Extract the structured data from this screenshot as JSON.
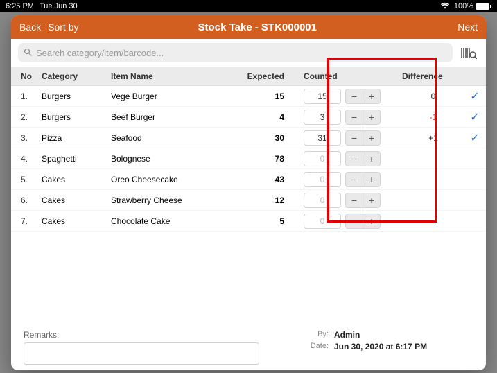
{
  "status": {
    "time": "6:25 PM",
    "date": "Tue Jun 30",
    "battery": "100%"
  },
  "topbar": {
    "back": "Back",
    "sort": "Sort by",
    "title": "Stock Take - STK000001",
    "next": "Next"
  },
  "search": {
    "placeholder": "Search category/item/barcode..."
  },
  "columns": {
    "no": "No",
    "category": "Category",
    "item": "Item Name",
    "expected": "Expected",
    "counted": "Counted",
    "difference": "Difference"
  },
  "rows": [
    {
      "no": "1.",
      "category": "Burgers",
      "name": "Vege Burger",
      "expected": "15",
      "counted": "15",
      "counted_placeholder": false,
      "diff": "0",
      "diff_sign": "zero",
      "checked": true
    },
    {
      "no": "2.",
      "category": "Burgers",
      "name": "Beef Burger",
      "expected": "4",
      "counted": "3",
      "counted_placeholder": false,
      "diff": "-1",
      "diff_sign": "neg",
      "checked": true
    },
    {
      "no": "3.",
      "category": "Pizza",
      "name": "Seafood",
      "expected": "30",
      "counted": "31",
      "counted_placeholder": false,
      "diff": "+1",
      "diff_sign": "pos",
      "checked": true
    },
    {
      "no": "4.",
      "category": "Spaghetti",
      "name": "Bolognese",
      "expected": "78",
      "counted": "0",
      "counted_placeholder": true,
      "diff": "",
      "diff_sign": "",
      "checked": false
    },
    {
      "no": "5.",
      "category": "Cakes",
      "name": "Oreo Cheesecake",
      "expected": "43",
      "counted": "0",
      "counted_placeholder": true,
      "diff": "",
      "diff_sign": "",
      "checked": false
    },
    {
      "no": "6.",
      "category": "Cakes",
      "name": "Strawberry Cheese",
      "expected": "12",
      "counted": "0",
      "counted_placeholder": true,
      "diff": "",
      "diff_sign": "",
      "checked": false
    },
    {
      "no": "7.",
      "category": "Cakes",
      "name": "Chocolate Cake",
      "expected": "5",
      "counted": "0",
      "counted_placeholder": true,
      "diff": "",
      "diff_sign": "",
      "checked": false
    }
  ],
  "remarks": {
    "label": "Remarks:"
  },
  "meta": {
    "by_label": "By:",
    "by": "Admin",
    "date_label": "Date:",
    "date": "Jun 30, 2020 at 6:17 PM"
  }
}
